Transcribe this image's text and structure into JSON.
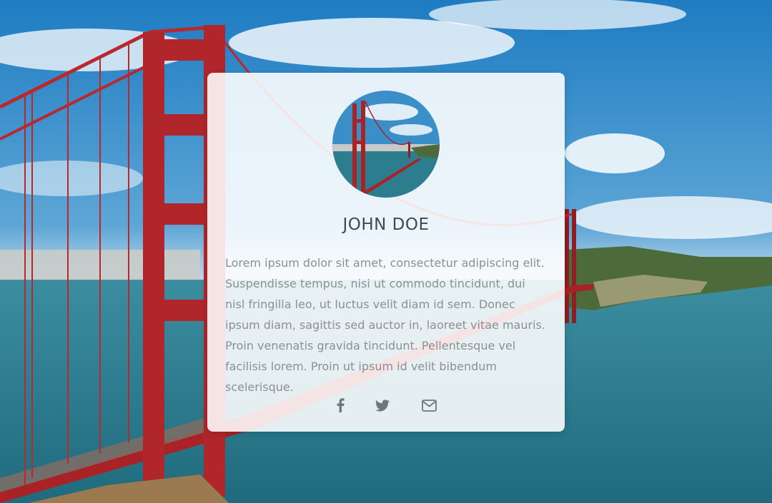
{
  "profile": {
    "name": "JOHN DOE",
    "bio": "Lorem ipsum dolor sit amet, consectetur adipiscing elit. Suspendisse tempus, nisi ut commodo tincidunt, dui nisl fringilla leo, ut luctus velit diam id sem. Donec ipsum diam, sagittis sed auctor in, laoreet vitae mauris. Proin venenatis gravida tincidunt. Pellentesque vel facilisis lorem. Proin ut ipsum id velit bibendum scelerisque."
  },
  "social_links": [
    {
      "icon": "facebook-icon"
    },
    {
      "icon": "twitter-icon"
    },
    {
      "icon": "envelope-icon"
    }
  ],
  "colors": {
    "card_background": "#ffffff",
    "name_text": "#3e4a52",
    "body_text": "#8a9096",
    "icon": "#6f767c",
    "bridge_red": "#b3262a",
    "sky_blue": "#2b86c5",
    "water_teal": "#2f7f8e"
  }
}
